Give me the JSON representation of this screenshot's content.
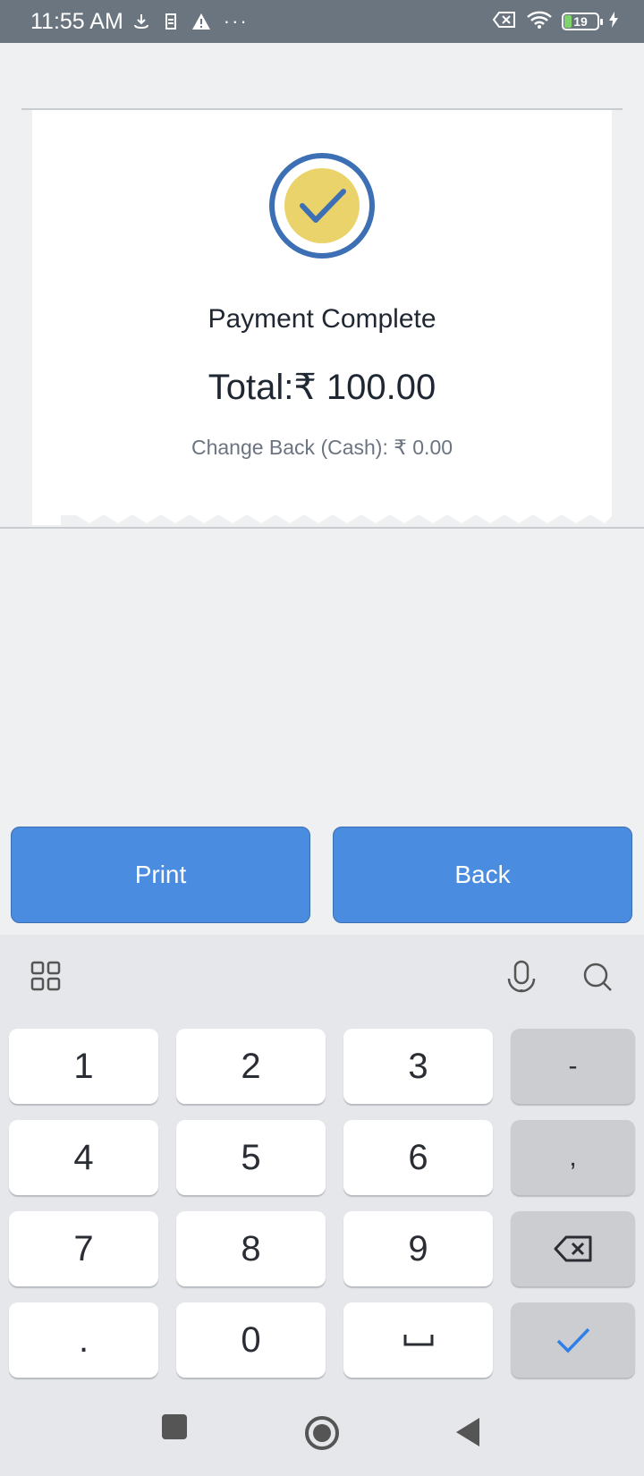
{
  "status_bar": {
    "time": "11:55 AM",
    "more": "···",
    "battery_level": "19",
    "icons_left": [
      "download-icon",
      "sim-icon",
      "warning-icon"
    ],
    "icons_right": [
      "no-sim-icon",
      "wifi-icon",
      "battery-icon",
      "charging-icon"
    ]
  },
  "receipt": {
    "status_icon": "check-circle-icon",
    "title": "Payment Complete",
    "total": "Total:₹ 100.00",
    "change": "Change Back (Cash):  ₹ 0.00"
  },
  "actions": {
    "print_label": "Print",
    "back_label": "Back"
  },
  "keyboard": {
    "toolbar_icons": [
      "apps-grid-icon",
      "microphone-icon",
      "search-icon"
    ],
    "keys": {
      "k1": "1",
      "k2": "2",
      "k3": "3",
      "minus": "-",
      "k4": "4",
      "k5": "5",
      "k6": "6",
      "comma": ",",
      "k7": "7",
      "k8": "8",
      "k9": "9",
      "dot": ".",
      "k0": "0"
    },
    "icon_keys": [
      "backspace-icon",
      "space-icon",
      "enter-check-icon"
    ]
  },
  "navigation": {
    "icons": [
      "recents-square-icon",
      "home-circle-icon",
      "back-triangle-icon"
    ]
  },
  "colors": {
    "status_bar": "#6b7580",
    "accent": "#4a8ce0",
    "check_fill": "#ebd36b",
    "check_ring": "#3d6fb5",
    "background": "#eff0f2"
  }
}
